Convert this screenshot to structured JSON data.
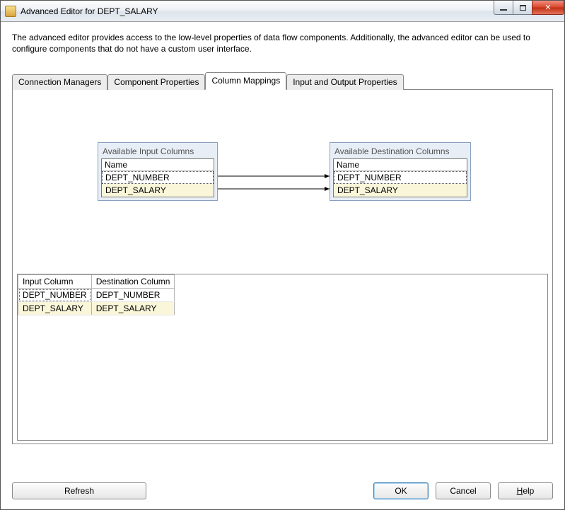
{
  "window": {
    "title": "Advanced Editor for DEPT_SALARY"
  },
  "description": "The advanced editor provides access to the low-level properties of data flow components. Additionally, the advanced editor can be used to configure components that do not have a custom user interface.",
  "tabs": [
    {
      "label": "Connection Managers"
    },
    {
      "label": "Component Properties"
    },
    {
      "label": "Column Mappings"
    },
    {
      "label": "Input and Output Properties"
    }
  ],
  "active_tab_index": 2,
  "source_box": {
    "title": "Available Input Columns",
    "header": "Name",
    "rows": [
      "DEPT_NUMBER",
      "DEPT_SALARY"
    ]
  },
  "dest_box": {
    "title": "Available Destination Columns",
    "header": "Name",
    "rows": [
      "DEPT_NUMBER",
      "DEPT_SALARY"
    ]
  },
  "mapping_grid": {
    "headers": [
      "Input Column",
      "Destination Column"
    ],
    "rows": [
      {
        "in": "DEPT_NUMBER",
        "out": "DEPT_NUMBER"
      },
      {
        "in": "DEPT_SALARY",
        "out": "DEPT_SALARY"
      }
    ]
  },
  "buttons": {
    "refresh": "Refresh",
    "ok": "OK",
    "cancel": "Cancel",
    "help_prefix": "H",
    "help_rest": "elp"
  }
}
